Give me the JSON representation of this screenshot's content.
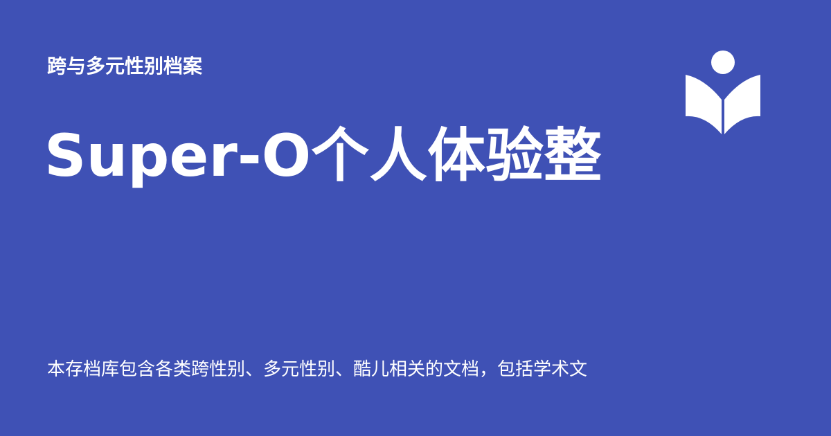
{
  "card": {
    "site_name": "跨与多元性别档案",
    "title": "Super-O个人体验整",
    "description": "本存档库包含各类跨性别、多元性别、酷儿相关的文档，包括学术文",
    "logo_icon": "reader-book-icon",
    "colors": {
      "background": "#3f51b5",
      "text": "#ffffff"
    }
  }
}
